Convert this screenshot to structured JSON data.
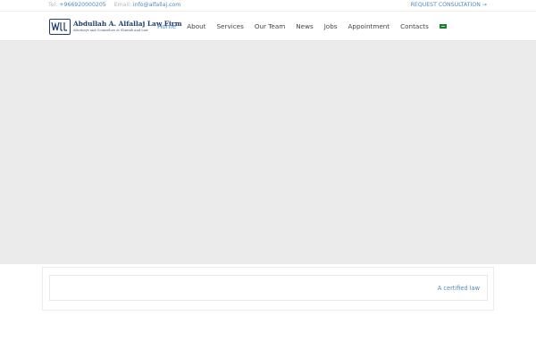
{
  "topbar": {
    "tel_label": "Tel:",
    "tel_value": "+966920000205",
    "email_label": "Email:",
    "email_value": "info@alfallaj.com",
    "consultation": "REQUEST CONSULTATION →"
  },
  "logo": {
    "name": "Abdullah A. Alfallaj Law Firm",
    "tagline": "Attorneys and Counselors at Shariah and Law"
  },
  "nav": {
    "items": [
      "Home",
      "About",
      "Services",
      "Our Team",
      "News",
      "Jobs",
      "Appointment",
      "Contacts"
    ],
    "active": "Home",
    "language_flag_icon": "saudi-flag-icon"
  },
  "certified": {
    "text": "A certified law"
  },
  "colors": {
    "accent": "#4e89c4",
    "brand_navy": "#1f3b6e",
    "hero_bg": "#ebebeb"
  }
}
